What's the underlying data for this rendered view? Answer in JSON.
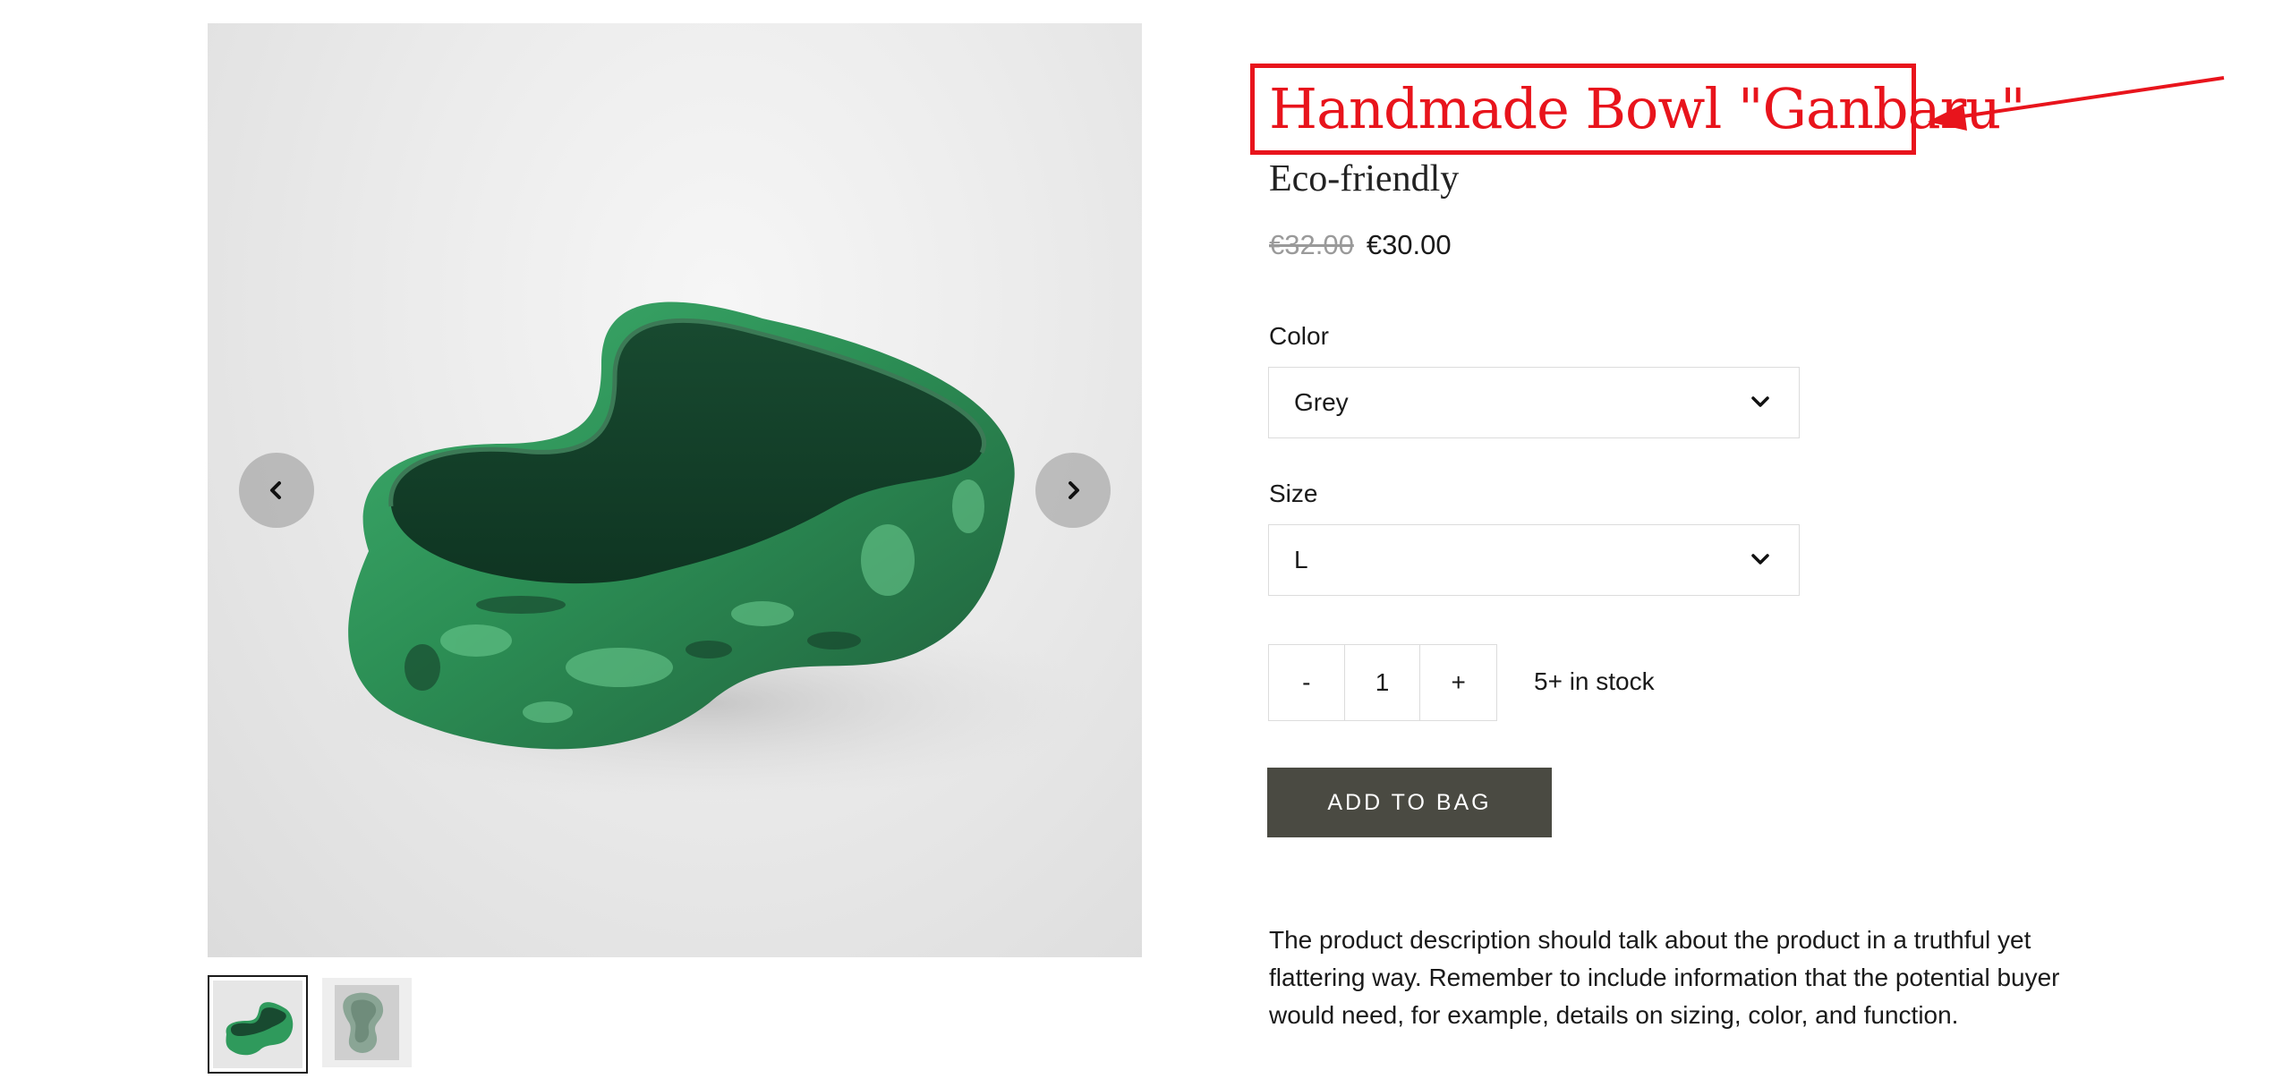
{
  "gallery": {
    "prev_icon": "chevron-left-icon",
    "next_icon": "chevron-right-icon",
    "thumbnail_count": 2
  },
  "product": {
    "title": "Handmade Bowl \"Ganbaru\"",
    "subtitle": "Eco-friendly",
    "price_old": "€32.00",
    "price_new": "€30.00",
    "description": "The product description should talk about the product in a truthful yet flattering way. Remember to include information that the potential buyer would need, for example, details on sizing, color, and function."
  },
  "options": {
    "color_label": "Color",
    "color_value": "Grey",
    "size_label": "Size",
    "size_value": "L"
  },
  "quantity": {
    "minus": "-",
    "value": "1",
    "plus": "+",
    "stock": "5+ in stock"
  },
  "actions": {
    "add_to_bag": "ADD TO BAG"
  },
  "annotation": {
    "highlight_color": "#e8141c"
  },
  "colors": {
    "button_bg": "#4a4a42",
    "bowl_green": "#2f9a5c"
  }
}
